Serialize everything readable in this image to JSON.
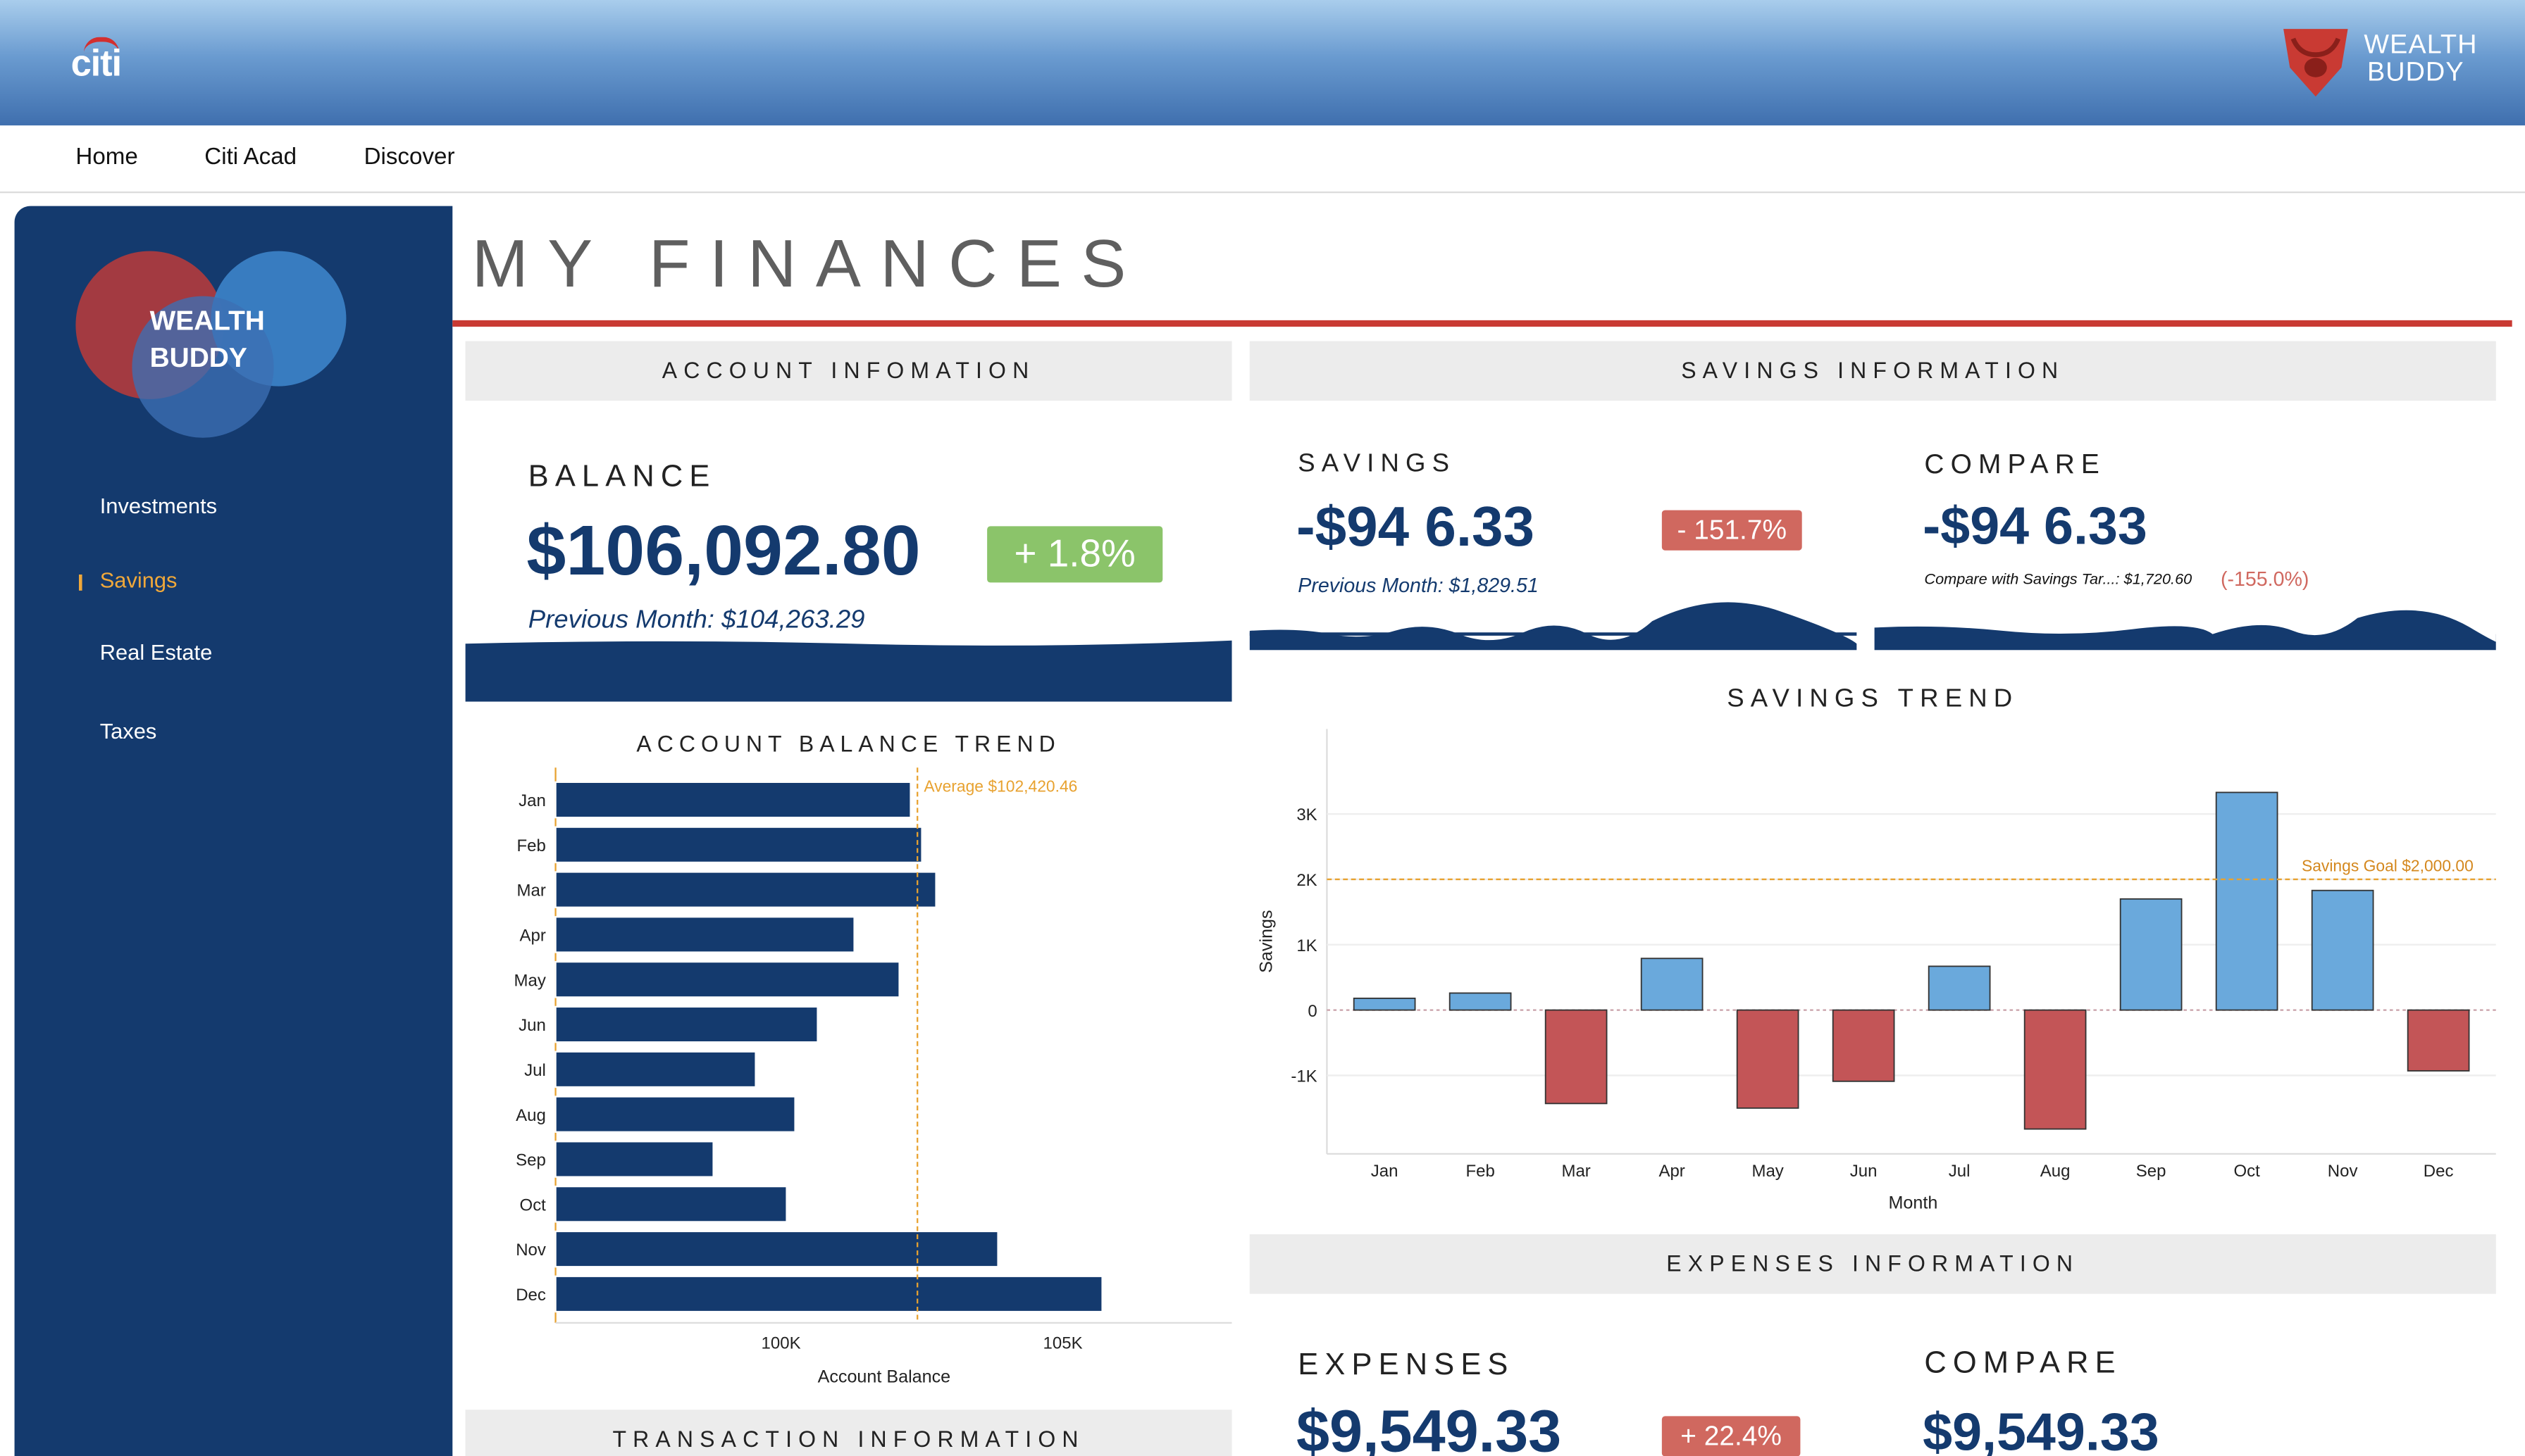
{
  "header": {
    "brand_left": "citi",
    "brand_right_line1": "WEALTH",
    "brand_right_line2": "BUDDY"
  },
  "nav": {
    "items": [
      "Home",
      "Citi Acad",
      "Discover"
    ]
  },
  "sidebar": {
    "logo_line1": "WEALTH",
    "logo_line2": "BUDDY",
    "items": [
      {
        "label": "Investments",
        "active": false
      },
      {
        "label": "Savings",
        "active": true
      },
      {
        "label": "Real Estate",
        "active": false
      },
      {
        "label": "Taxes",
        "active": false
      }
    ]
  },
  "page": {
    "title": "MY FINANCES"
  },
  "account": {
    "section_title": "ACCOUNT INFOMATION",
    "balance_label": "BALANCE",
    "balance_value": "$106,092.80",
    "balance_change": "+ 1.8%",
    "previous_month": "Previous Month: $104,263.29"
  },
  "savings_section": {
    "section_title": "SAVINGS INFORMATION",
    "savings_label": "SAVINGS",
    "savings_value": "-$94 6.33",
    "savings_change": "- 151.7%",
    "previous_month": "Previous Month: $1,829.51",
    "compare_label": "COMPARE",
    "compare_value": "-$94  6.33",
    "compare_text": "Compare with Savings Tar...: $1,720.60",
    "compare_change": "(-155.0%)"
  },
  "expenses_section": {
    "section_title": "EXPENSES INFORMATION",
    "expenses_label": "EXPENSES",
    "expenses_value": "$9,549.33",
    "expenses_change": "+ 22.4%",
    "compare_label": "COMPARE",
    "compare_value": "$9,549.33"
  },
  "transaction_section": {
    "section_title": "TRANSACTION INFORMATION"
  },
  "colors": {
    "navy": "#143a6e",
    "accent_red": "#c93a33",
    "positive_green": "#8bc46a",
    "negative_red": "#d0685f",
    "bar_blue": "#6aa9dc",
    "bar_red": "#c35557",
    "average_orange": "#e8a230"
  },
  "chart_data": [
    {
      "type": "bar",
      "orientation": "horizontal",
      "title": "ACCOUNT BALANCE TREND",
      "xlabel": "Account Balance",
      "ylabel": "",
      "categories": [
        "Jan",
        "Feb",
        "Mar",
        "Apr",
        "May",
        "Jun",
        "Jul",
        "Aug",
        "Sep",
        "Oct",
        "Nov",
        "Dec"
      ],
      "values": [
        102300,
        102500,
        102750,
        101300,
        102100,
        100650,
        99550,
        100250,
        98800,
        100100,
        103850,
        105700
      ],
      "xlim": [
        96000,
        108000
      ],
      "xticks": [
        "100K",
        "105K"
      ],
      "reference_line": {
        "label": "Average $102,420.46",
        "value": 102420.46
      }
    },
    {
      "type": "bar",
      "title": "SAVINGS TREND",
      "xlabel": "Month",
      "ylabel": "Savings",
      "categories": [
        "Jan",
        "Feb",
        "Mar",
        "Apr",
        "May",
        "Jun",
        "Jul",
        "Aug",
        "Sep",
        "Oct",
        "Nov",
        "Dec"
      ],
      "values": [
        180,
        260,
        -1430,
        790,
        -1500,
        -1090,
        670,
        -1820,
        1700,
        3330,
        1830,
        -930
      ],
      "ylim": [
        -2200,
        4300
      ],
      "yticks": [
        "3K",
        "2K",
        "1K",
        "0",
        "-1K"
      ],
      "reference_line": {
        "label": "Savings Goal $2,000.00",
        "value": 2000
      }
    }
  ]
}
